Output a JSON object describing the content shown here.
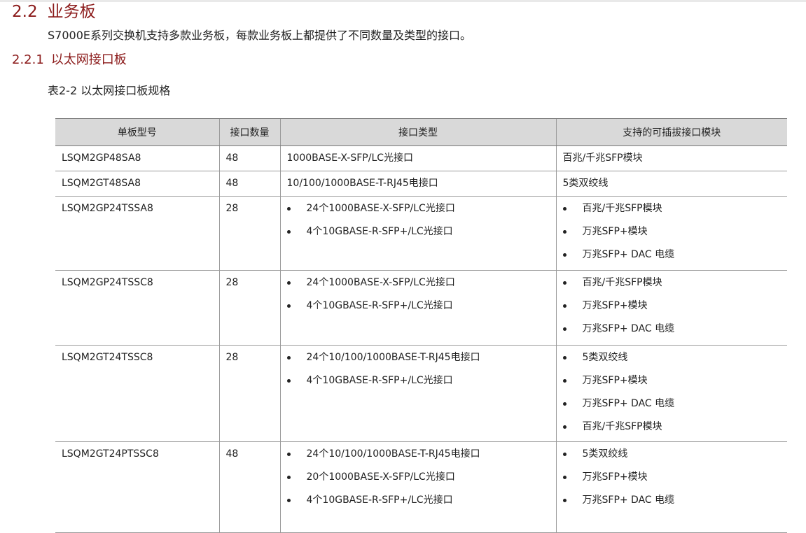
{
  "section": {
    "number": "2.2",
    "title": "业务板"
  },
  "intro": "S7000E系列交换机支持多款业务板，每款业务板上都提供了不同数量及类型的接口。",
  "subsection": {
    "number": "2.2.1",
    "title": "以太网接口板"
  },
  "table_caption": "表2-2 以太网接口板规格",
  "table": {
    "headers": [
      "单板型号",
      "接口数量",
      "接口类型",
      "支持的可插拔接口模块"
    ],
    "rows": [
      {
        "model": "LSQM2GP48SA8",
        "count": "48",
        "types": [
          "1000BASE-X-SFP/LC光接口"
        ],
        "modules": [
          "百兆/千兆SFP模块"
        ]
      },
      {
        "model": "LSQM2GT48SA8",
        "count": "48",
        "types": [
          "10/100/1000BASE-T-RJ45电接口"
        ],
        "modules": [
          "5类双绞线"
        ]
      },
      {
        "model": "LSQM2GP24TSSA8",
        "count": "28",
        "types": [
          "24个1000BASE-X-SFP/LC光接口",
          "4个10GBASE-R-SFP+/LC光接口"
        ],
        "modules": [
          "百兆/千兆SFP模块",
          "万兆SFP+模块",
          "万兆SFP+ DAC 电缆"
        ]
      },
      {
        "model": "LSQM2GP24TSSC8",
        "count": "28",
        "types": [
          "24个1000BASE-X-SFP/LC光接口",
          "4个10GBASE-R-SFP+/LC光接口"
        ],
        "modules": [
          "百兆/千兆SFP模块",
          "万兆SFP+模块",
          "万兆SFP+ DAC 电缆"
        ]
      },
      {
        "model": "LSQM2GT24TSSC8",
        "count": "28",
        "types": [
          "24个10/100/1000BASE-T-RJ45电接口",
          "4个10GBASE-R-SFP+/LC光接口"
        ],
        "modules": [
          "5类双绞线",
          "万兆SFP+模块",
          "万兆SFP+ DAC 电缆",
          "百兆/千兆SFP模块"
        ]
      },
      {
        "model": "LSQM2GT24PTSSC8",
        "count": "48",
        "types": [
          "24个10/100/1000BASE-T-RJ45电接口",
          "20个1000BASE-X-SFP/LC光接口",
          "4个10GBASE-R-SFP+/LC光接口"
        ],
        "modules": [
          "5类双绞线",
          "万兆SFP+模块",
          "万兆SFP+ DAC 电缆"
        ]
      }
    ]
  }
}
